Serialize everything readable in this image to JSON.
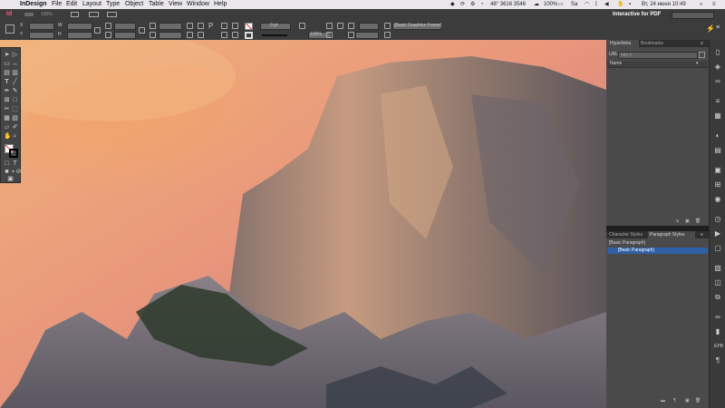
{
  "menubar": {
    "app_name": "InDesign",
    "items": [
      "File",
      "Edit",
      "Layout",
      "Type",
      "Object",
      "Table",
      "View",
      "Window",
      "Help"
    ],
    "status": {
      "coords": "48° 3616 3546",
      "battery": "100%",
      "input_lang": "Sa",
      "clock": "Вт, 24 июня 10:49"
    }
  },
  "app_bar": {
    "logo": "Id",
    "zoom": "100%",
    "workspace": "Interactive for PDF"
  },
  "control_bar": {
    "paragraph_style": "[Basic Graphics Frame]",
    "stroke_weight": "0 pt",
    "opacity": "100%"
  },
  "hyperlinks_panel": {
    "tabs": [
      "Hyperlinks",
      "Bookmarks"
    ],
    "url_label": "URL:",
    "url_value": "http://",
    "name_header": "Name"
  },
  "styles_panel": {
    "tabs": [
      "Character Styles",
      "Paragraph Styles"
    ],
    "current": "[Basic Paragraph]",
    "items": [
      "[Basic Paragraph]"
    ]
  },
  "colors": {
    "sky": "#e79a7d",
    "panel_bg": "#4a4a4a",
    "highlight": "#2f5fa5"
  }
}
